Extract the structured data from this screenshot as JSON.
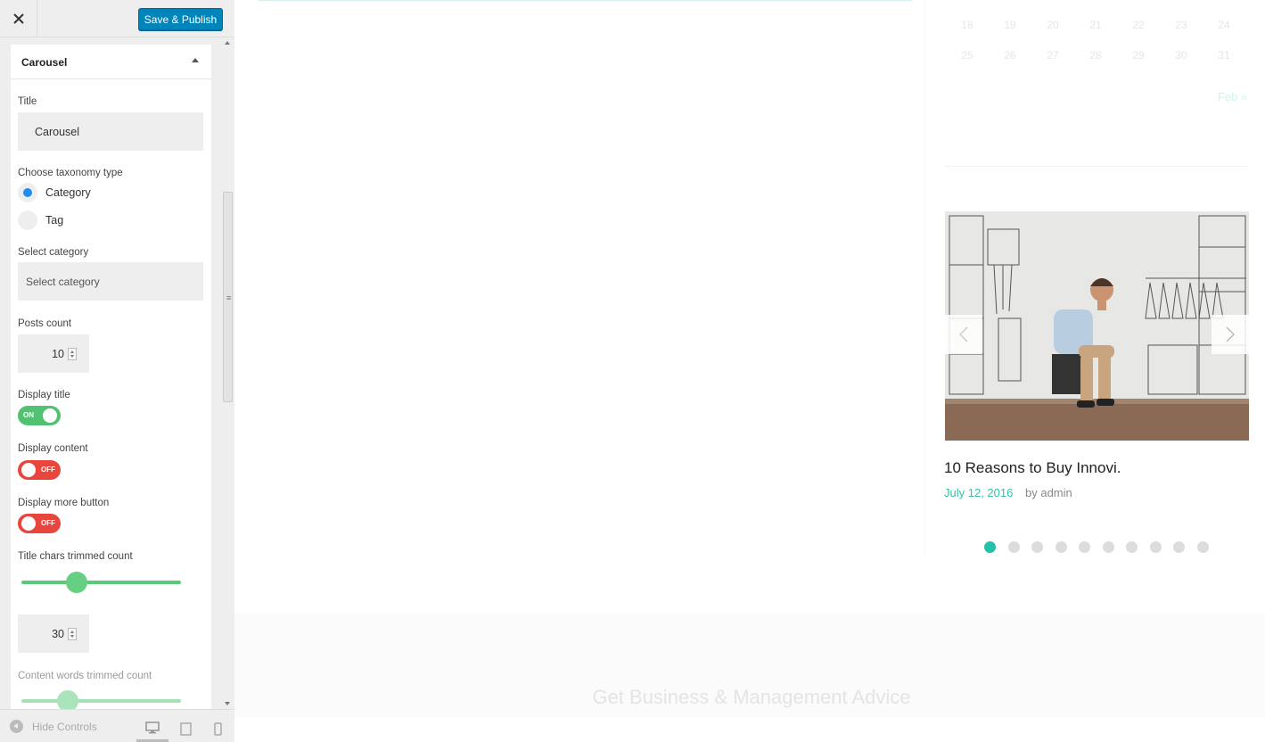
{
  "panel": {
    "close_label": "✕",
    "save_label": "Save & Publish",
    "section_title": "Carousel",
    "fields": {
      "title_label": "Title",
      "title_value": "Carousel",
      "taxonomy_label": "Choose taxonomy type",
      "taxonomy_options": [
        "Category",
        "Tag"
      ],
      "taxonomy_selected": "Category",
      "category_label": "Select category",
      "category_placeholder": "Select category",
      "posts_count_label": "Posts count",
      "posts_count_value": "10",
      "display_title_label": "Display title",
      "display_title_state": "ON",
      "display_content_label": "Display content",
      "display_content_state": "OFF",
      "display_more_label": "Display more button",
      "display_more_state": "OFF",
      "title_chars_label": "Title chars trimmed count",
      "title_chars_slider_fraction": 0.32,
      "title_chars_value": "30",
      "content_words_label": "Content words trimmed count"
    },
    "footer": {
      "hide_controls": "Hide Controls",
      "devices": [
        "desktop-icon",
        "tablet-icon",
        "mobile-icon"
      ],
      "active_device": "desktop"
    }
  },
  "preview": {
    "calendar_rows": [
      [
        "18",
        "19",
        "20",
        "21",
        "22",
        "23",
        "24"
      ],
      [
        "25",
        "26",
        "27",
        "28",
        "29",
        "30",
        "31"
      ]
    ],
    "calendar_next": "Feb »",
    "post": {
      "title": "10 Reasons to Buy Innovi.",
      "date": "July 12, 2016",
      "author": "by admin"
    },
    "dots_count": 10,
    "active_dot": 0,
    "footer_title": "Get Business & Management Advice"
  },
  "colors": {
    "accent_teal": "#22c1a8",
    "save_blue": "#0085ba",
    "toggle_on": "#52c272",
    "toggle_off": "#e8453c",
    "radio_selected": "#1e8cf0"
  }
}
